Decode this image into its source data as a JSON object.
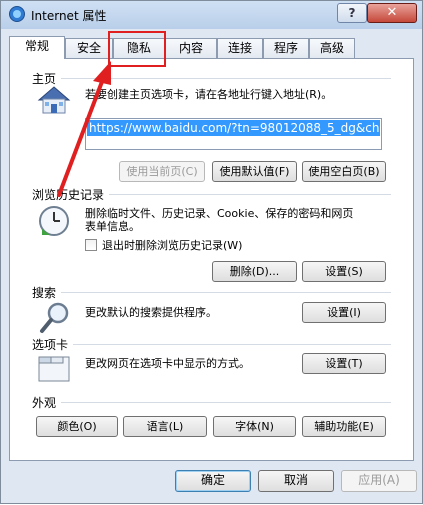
{
  "window": {
    "title": "Internet 属性",
    "help_label": "?",
    "close_label": "✕"
  },
  "tabs": [
    {
      "label": "常规",
      "active": true
    },
    {
      "label": "安全"
    },
    {
      "label": "隐私",
      "highlighted": true
    },
    {
      "label": "内容"
    },
    {
      "label": "连接"
    },
    {
      "label": "程序"
    },
    {
      "label": "高级"
    }
  ],
  "homepage": {
    "title": "主页",
    "description": "若要创建主页选项卡，请在各地址行键入地址(R)。",
    "url": "https://www.baidu.com/?tn=98012088_5_dg&ch",
    "use_current_label": "使用当前页(C)",
    "use_default_label": "使用默认值(F)",
    "use_blank_label": "使用空白页(B)"
  },
  "history": {
    "title": "浏览历史记录",
    "description_line1": "删除临时文件、历史记录、Cookie、保存的密码和网页",
    "description_line2": "表单信息。",
    "checkbox_label": "退出时删除浏览历史记录(W)",
    "delete_label": "删除(D)...",
    "settings_label": "设置(S)"
  },
  "search": {
    "title": "搜索",
    "description": "更改默认的搜索提供程序。",
    "settings_label": "设置(I)"
  },
  "tabs_section": {
    "title": "选项卡",
    "description": "更改网页在选项卡中显示的方式。",
    "settings_label": "设置(T)"
  },
  "appearance": {
    "title": "外观",
    "colors_label": "颜色(O)",
    "languages_label": "语言(L)",
    "fonts_label": "字体(N)",
    "accessibility_label": "辅助功能(E)"
  },
  "footer": {
    "ok_label": "确定",
    "cancel_label": "取消",
    "apply_label": "应用(A)"
  },
  "colors": {
    "annotation": "#e02020",
    "selection": "#3399ff"
  }
}
